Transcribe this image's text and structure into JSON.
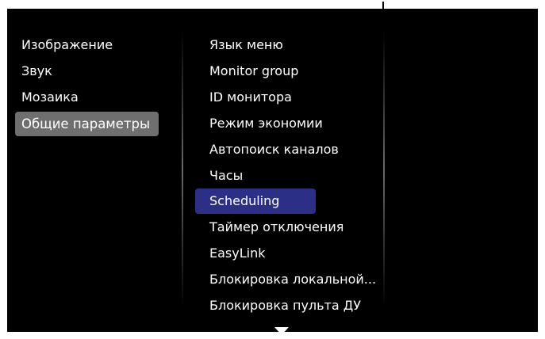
{
  "colors": {
    "background": "#000000",
    "selected_category": "#6f6f6f",
    "selected_item": "#2b2f86",
    "text": "#ffffff"
  },
  "categories": [
    {
      "label": "Изображение"
    },
    {
      "label": "Звук"
    },
    {
      "label": "Мозаика"
    },
    {
      "label": "Общие параметры",
      "selected": true
    }
  ],
  "submenu": [
    {
      "label": "Язык меню"
    },
    {
      "label": "Monitor group"
    },
    {
      "label": "ID монитора"
    },
    {
      "label": "Режим экономии"
    },
    {
      "label": "Автопоиск каналов"
    },
    {
      "label": "Часы"
    },
    {
      "label": "Scheduling",
      "selected": true
    },
    {
      "label": "Таймер отключения"
    },
    {
      "label": "EasyLink"
    },
    {
      "label": "Блокировка локальной..."
    },
    {
      "label": "Блокировка пульта ДУ"
    }
  ],
  "scroll_indicator": "arrow-down-icon"
}
